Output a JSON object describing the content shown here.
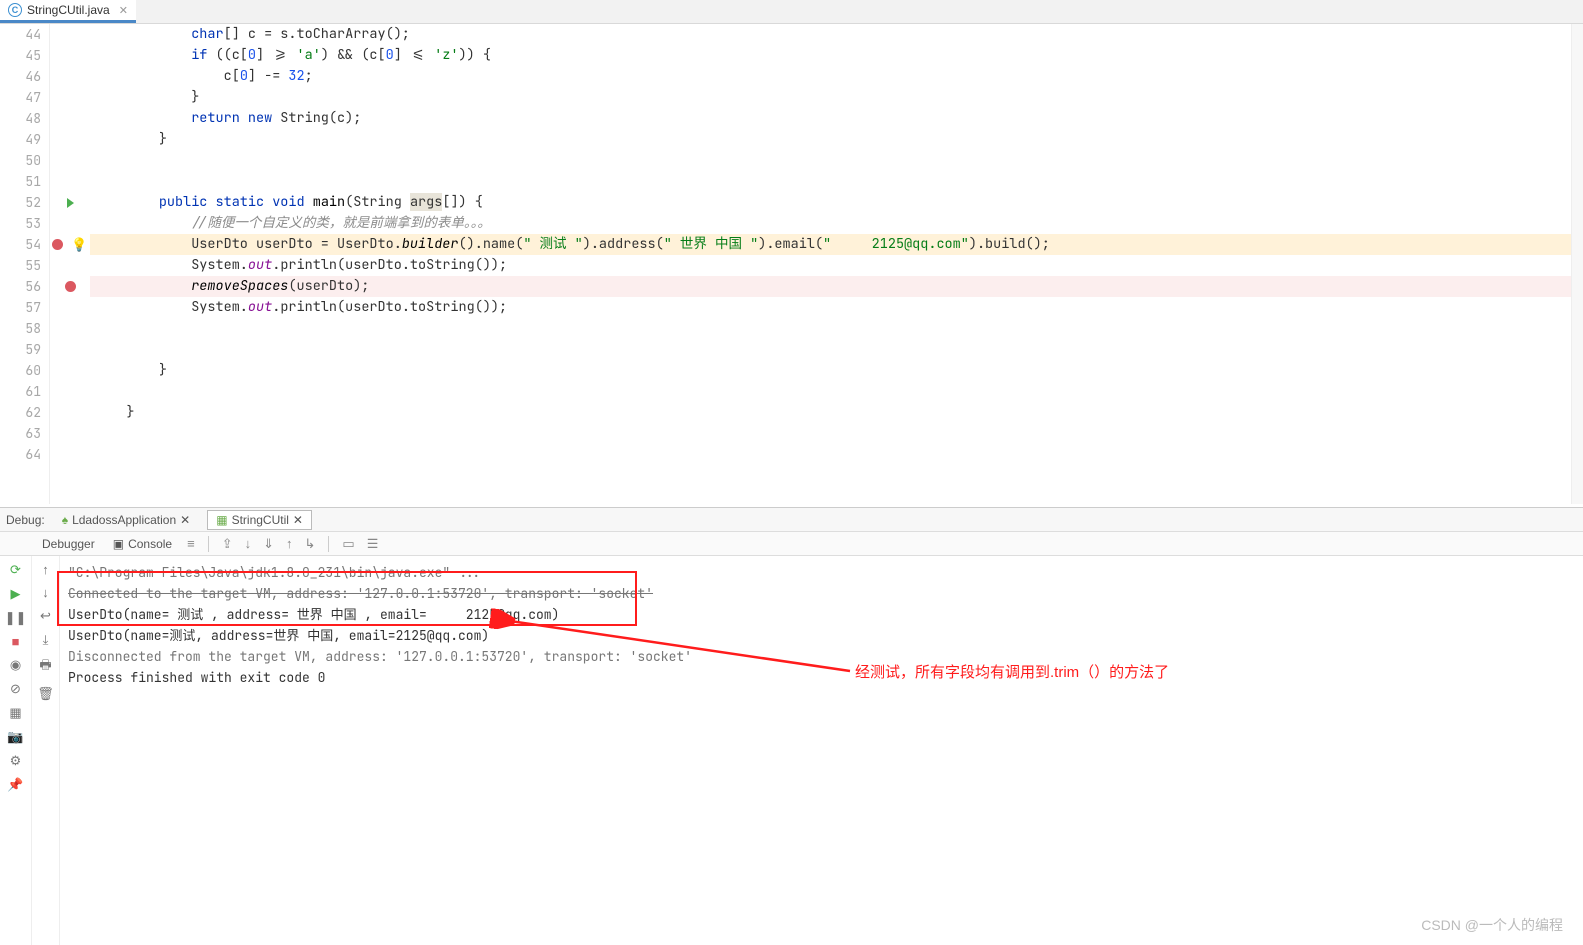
{
  "tab": {
    "filename": "StringCUtil.java"
  },
  "gutter_lines": [
    "44",
    "45",
    "46",
    "47",
    "48",
    "49",
    "50",
    "51",
    "52",
    "53",
    "54",
    "55",
    "56",
    "57",
    "58",
    "59",
    "60",
    "61",
    "62",
    "63",
    "64"
  ],
  "code": {
    "l44": {
      "pre": "            ",
      "kw1": "char",
      "txt1": "[] c = s.toCharArray();"
    },
    "l45": {
      "pre": "            ",
      "kw1": "if",
      "t1": " ((c[",
      "n1": "0",
      "t2": "] >= ",
      "s1": "'a'",
      "t3": ") && (c[",
      "n2": "0",
      "t4": "] <= ",
      "s2": "'z'",
      "t5": ")) {"
    },
    "l46": {
      "pre": "                ",
      "t1": "c[",
      "n1": "0",
      "t2": "] -= ",
      "n2": "32",
      "t3": ";"
    },
    "l47": {
      "pre": "            ",
      "t": "}"
    },
    "l48": {
      "pre": "            ",
      "kw1": "return new",
      "t1": " String(c);"
    },
    "l49": {
      "pre": "        ",
      "t": "}"
    },
    "l50": {
      "t": ""
    },
    "l51": {
      "t": ""
    },
    "l52": {
      "pre": "        ",
      "kw1": "public static void",
      "fn": " main",
      "t1": "(String ",
      "arg": "args",
      "t2": "[]) {"
    },
    "l53": {
      "pre": "            ",
      "com": "//随便一个自定义的类，就是前端拿到的表单。。。"
    },
    "l54": {
      "pre": "            ",
      "t1": "UserDto userDto = UserDto.",
      "fi": "builder",
      "t2": "().name(",
      "s1": "\" 测试 \"",
      "t3": ").address(",
      "s2": "\" 世界 中国 \"",
      "t4": ").email(",
      "s3": "\"     2125@qq.com\"",
      "t5": ").build();"
    },
    "l55": {
      "pre": "            ",
      "t1": "System.",
      "fld": "out",
      "t2": ".println(userDto.toString());"
    },
    "l56": {
      "pre": "            ",
      "fi": "removeSpaces",
      "t": "(userDto);"
    },
    "l57": {
      "pre": "            ",
      "t1": "System.",
      "fld": "out",
      "t2": ".println(userDto.toString());"
    },
    "l58": {
      "t": ""
    },
    "l59": {
      "t": ""
    },
    "l60": {
      "pre": "        ",
      "t": "}"
    },
    "l61": {
      "t": ""
    },
    "l62": {
      "pre": "    ",
      "t": "}"
    },
    "l63": {
      "t": ""
    },
    "l64": {
      "t": ""
    }
  },
  "debug": {
    "label": "Debug:",
    "tab1": "LdadossApplication",
    "tab2": "StringCUtil",
    "debugger": "Debugger",
    "console": "Console"
  },
  "console": {
    "l1": "\"C:\\Program Files\\Java\\jdk1.8.0_231\\bin\\java.exe\" ...",
    "l2": "Connected to the target VM, address: '127.0.0.1:53720', transport: 'socket'",
    "l3": "UserDto(name= 测试 , address= 世界 中国 , email=     2125@qq.com)",
    "l4": "UserDto(name=测试, address=世界 中国, email=2125@qq.com)",
    "l5": "Disconnected from the target VM, address: '127.0.0.1:53720', transport: 'socket'",
    "l6": "",
    "l7": "Process finished with exit code 0"
  },
  "annotation": "经测试，所有字段均有调用到.trim（）的方法了",
  "watermark": "CSDN @一个人的编程"
}
